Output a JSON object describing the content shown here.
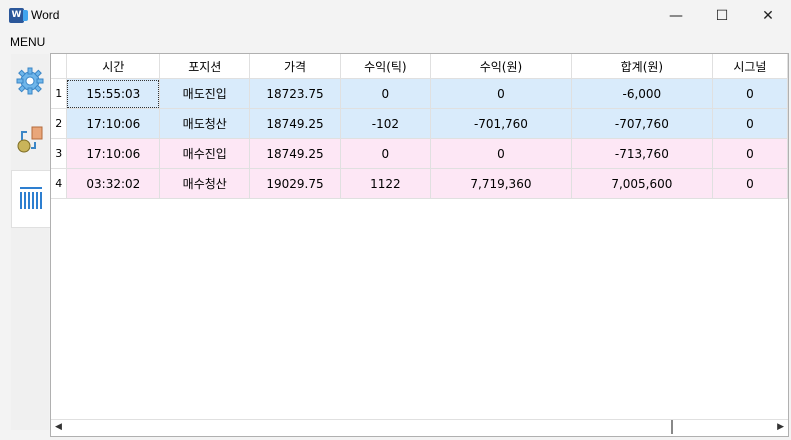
{
  "window": {
    "title": "Word",
    "app_icon_letter": "W"
  },
  "controls": {
    "minimize": "—",
    "maximize": "☐",
    "close": "✕"
  },
  "menu": {
    "label": "MENU"
  },
  "tabs": [
    {
      "icon": "gear-icon"
    },
    {
      "icon": "exchange-icon"
    },
    {
      "icon": "barcode-icon"
    }
  ],
  "table": {
    "headers": [
      "시간",
      "포지션",
      "가격",
      "수익(틱)",
      "수익(원)",
      "합계(원)",
      "시그널"
    ],
    "rows": [
      {
        "num": "1",
        "cells": [
          "15:55:03",
          "매도진입",
          "18723.75",
          "0",
          "0",
          "-6,000",
          "0"
        ]
      },
      {
        "num": "2",
        "cells": [
          "17:10:06",
          "매도청산",
          "18749.25",
          "-102",
          "-701,760",
          "-707,760",
          "0"
        ]
      },
      {
        "num": "3",
        "cells": [
          "17:10:06",
          "매수진입",
          "18749.25",
          "0",
          "0",
          "-713,760",
          "0"
        ]
      },
      {
        "num": "4",
        "cells": [
          "03:32:02",
          "매수청산",
          "19029.75",
          "1122",
          "7,719,360",
          "7,005,600",
          "0"
        ]
      }
    ]
  },
  "colors": {
    "short_row": "#d9ebfb",
    "long_row": "#fde7f5"
  },
  "scrollbar": {
    "left": "◀",
    "right": "▶"
  }
}
